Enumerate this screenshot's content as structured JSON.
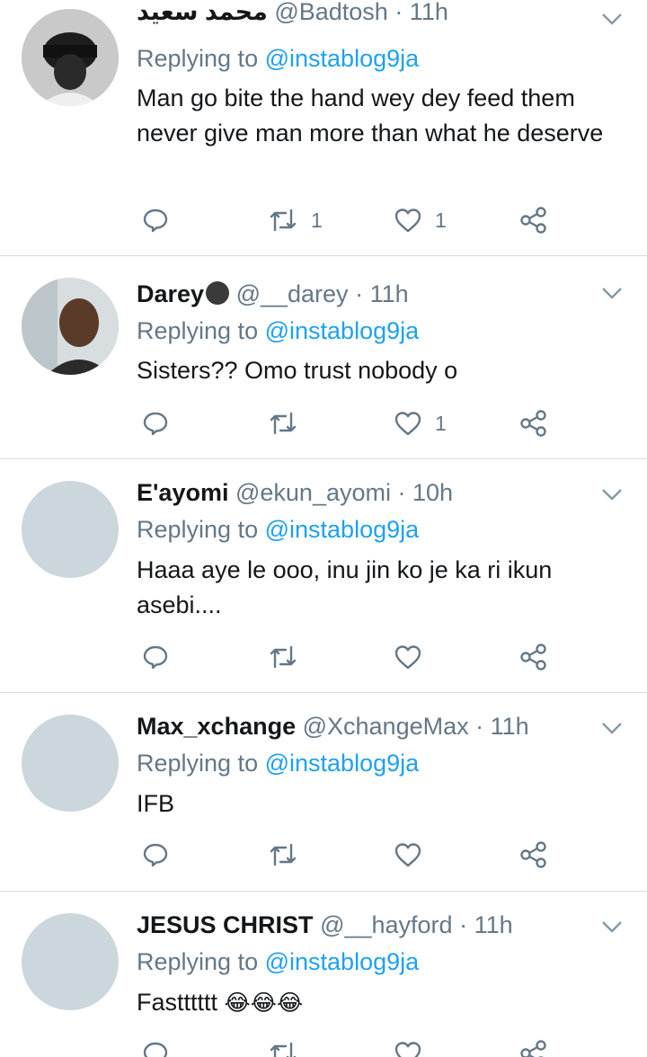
{
  "tweets": [
    {
      "name": "محمد سعيد",
      "handle": "@Badtosh",
      "time": "· 11h",
      "replying_prefix": "Replying to",
      "replying_handle": "@instablog9ja",
      "text": "Man go bite the hand wey dey feed them never give man more than what he deserve",
      "retweets": "1",
      "likes": "1"
    },
    {
      "name": "Darey",
      "handle": "@__darey",
      "time": "· 11h",
      "replying_prefix": "Replying to",
      "replying_handle": "@instablog9ja",
      "text": "Sisters?? Omo trust nobody o",
      "retweets": "",
      "likes": "1"
    },
    {
      "name": "E'ayomi",
      "handle": "@ekun_ayomi",
      "time": "· 10h",
      "replying_prefix": "Replying to",
      "replying_handle": "@instablog9ja",
      "text": "Haaa aye le ooo, inu jin ko je ka ri ikun asebi....",
      "retweets": "",
      "likes": ""
    },
    {
      "name": "Max_xchange",
      "handle": "@XchangeMax",
      "time": "· 11h",
      "replying_prefix": "Replying to",
      "replying_handle": "@instablog9ja",
      "text": "IFB",
      "retweets": "",
      "likes": ""
    },
    {
      "name": "JESUS CHRIST",
      "handle": "@__hayford",
      "time": "· 11h",
      "replying_prefix": "Replying to",
      "replying_handle": "@instablog9ja",
      "text": "Fastttttt",
      "emoji": "😂😂😂",
      "retweets": "",
      "likes": ""
    }
  ],
  "icons": {
    "reply": "reply-icon",
    "retweet": "retweet-icon",
    "like": "heart-icon",
    "share": "share-icon",
    "caret": "chevron-down-icon"
  },
  "colors": {
    "link": "#1da1f2",
    "muted": "#657786",
    "text": "#14171a",
    "divider": "#d6dde3",
    "avatar_placeholder": "#ccd6dd"
  }
}
